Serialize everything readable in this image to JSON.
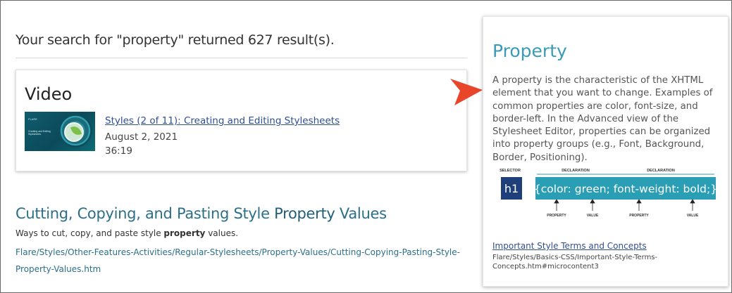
{
  "search": {
    "summary": "Your search for \"property\" returned 627 result(s)."
  },
  "video_card": {
    "heading": "Video",
    "thumbnail": {
      "brand": "FLARE",
      "caption": "Creating and Editing Stylesheets"
    },
    "link": "Styles (2 of 11): Creating and Editing Stylesheets",
    "date": "August 2, 2021",
    "duration": "36:19"
  },
  "result": {
    "title_before": "Cutting, Copying, and Pasting Style ",
    "title_highlight": "Property",
    "title_after": " Values",
    "desc_before": "Ways to cut, copy, and paste style ",
    "desc_highlight": "property",
    "desc_after": " values.",
    "path": "Flare/Styles/Other-Features-Activities/Regular-Stylesheets/Property-Values/Cutting-Copying-Pasting-Style-Property-Values.htm"
  },
  "popover": {
    "title": "Property",
    "text": "A property is the characteristic of the XHTML element that you want to change. Examples of common properties are color, font-size, and border-left. In the Advanced view of the Stylesheet Editor, properties can be organized into property groups (e.g., Font, Background, Border, Positioning).",
    "diagram": {
      "selector_label": "SELECTOR",
      "declaration_label_1": "DECLARATION",
      "declaration_label_2": "DECLARATION",
      "selector_text": "h1",
      "declaration_text": "{color: green; font-weight: bold;}",
      "property_label_1": "PROPERTY",
      "value_label_1": "VALUE",
      "property_label_2": "PROPERTY",
      "value_label_2": "VALUE",
      "selector_color": "#1e3f7a",
      "declaration_color": "#2a9eb4"
    },
    "link": "Important Style Terms and Concepts",
    "path": "Flare/Styles/Basics-CSS/Important-Style-Terms-Concepts.htm#microcontent3"
  },
  "colors": {
    "accent": "#3a9bb8",
    "arrow": "#e8452a",
    "link": "#2f4f8f"
  }
}
